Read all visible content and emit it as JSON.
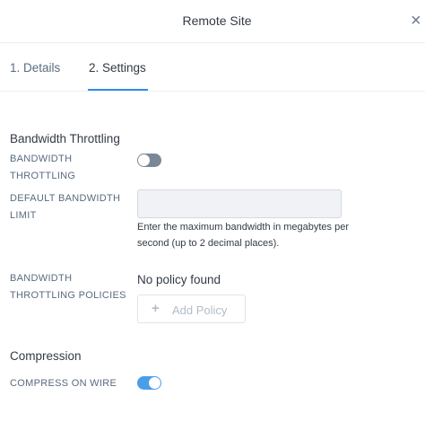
{
  "header": {
    "title": "Remote Site",
    "close_glyph": "×"
  },
  "tabs": [
    {
      "label": "1. Details",
      "active": false
    },
    {
      "label": "2. Settings",
      "active": true
    }
  ],
  "bandwidth": {
    "section_title": "Bandwidth Throttling",
    "throttling_label_line1": "BANDWIDTH",
    "throttling_label_line2": "THROTTLING",
    "throttling_enabled": false,
    "limit_label_line1": "DEFAULT BANDWIDTH",
    "limit_label_line2": "LIMIT",
    "limit_value": "",
    "limit_help_line1": "Enter the maximum bandwidth in megabytes per",
    "limit_help_line2": "second (up to 2 decimal places).",
    "policies_label_line1": "BANDWIDTH",
    "policies_label_line2": "THROTTLING POLICIES",
    "no_policy_text": "No policy found",
    "add_policy_label": "Add Policy",
    "add_policy_icon": "plus-icon"
  },
  "compression": {
    "section_title": "Compression",
    "compress_label": "COMPRESS ON WIRE",
    "compress_enabled": true
  },
  "colors": {
    "accent": "#2f8de4",
    "toggle_on": "#4a9ee8",
    "toggle_off": "#7a8796",
    "label_gray": "#5a6b80"
  }
}
